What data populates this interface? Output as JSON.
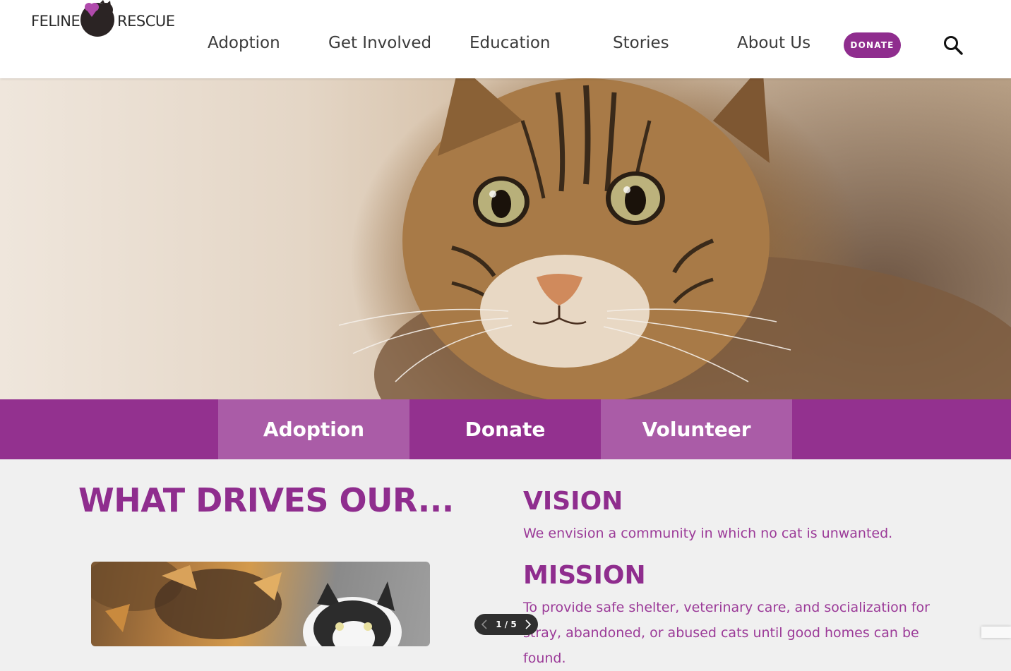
{
  "header": {
    "logo": {
      "left_text": "FELINE",
      "right_text": "RESCUE"
    },
    "nav": [
      {
        "label": "Adoption"
      },
      {
        "label": "Get Involved"
      },
      {
        "label": "Education"
      },
      {
        "label": "Stories"
      },
      {
        "label": "About Us"
      }
    ],
    "donate_label": "DONATE",
    "search_icon": "search-icon"
  },
  "action_bar": {
    "tiles": [
      {
        "label": "Adoption"
      },
      {
        "label": "Donate"
      },
      {
        "label": "Volunteer"
      }
    ]
  },
  "content": {
    "heading": "WHAT DRIVES OUR...",
    "vision": {
      "title": "VISION",
      "text": "We envision a community in which no cat is unwanted."
    },
    "mission": {
      "title": "MISSION",
      "text": "To provide safe shelter, veterinary care, and socialization for stray, abandoned, or abused cats until good homes can be found."
    }
  },
  "slider": {
    "counter": "1 / 5"
  },
  "colors": {
    "brand_purple": "#93318f",
    "tile_light_purple": "#aa5ca7",
    "text_purple": "#8f2d8e"
  }
}
